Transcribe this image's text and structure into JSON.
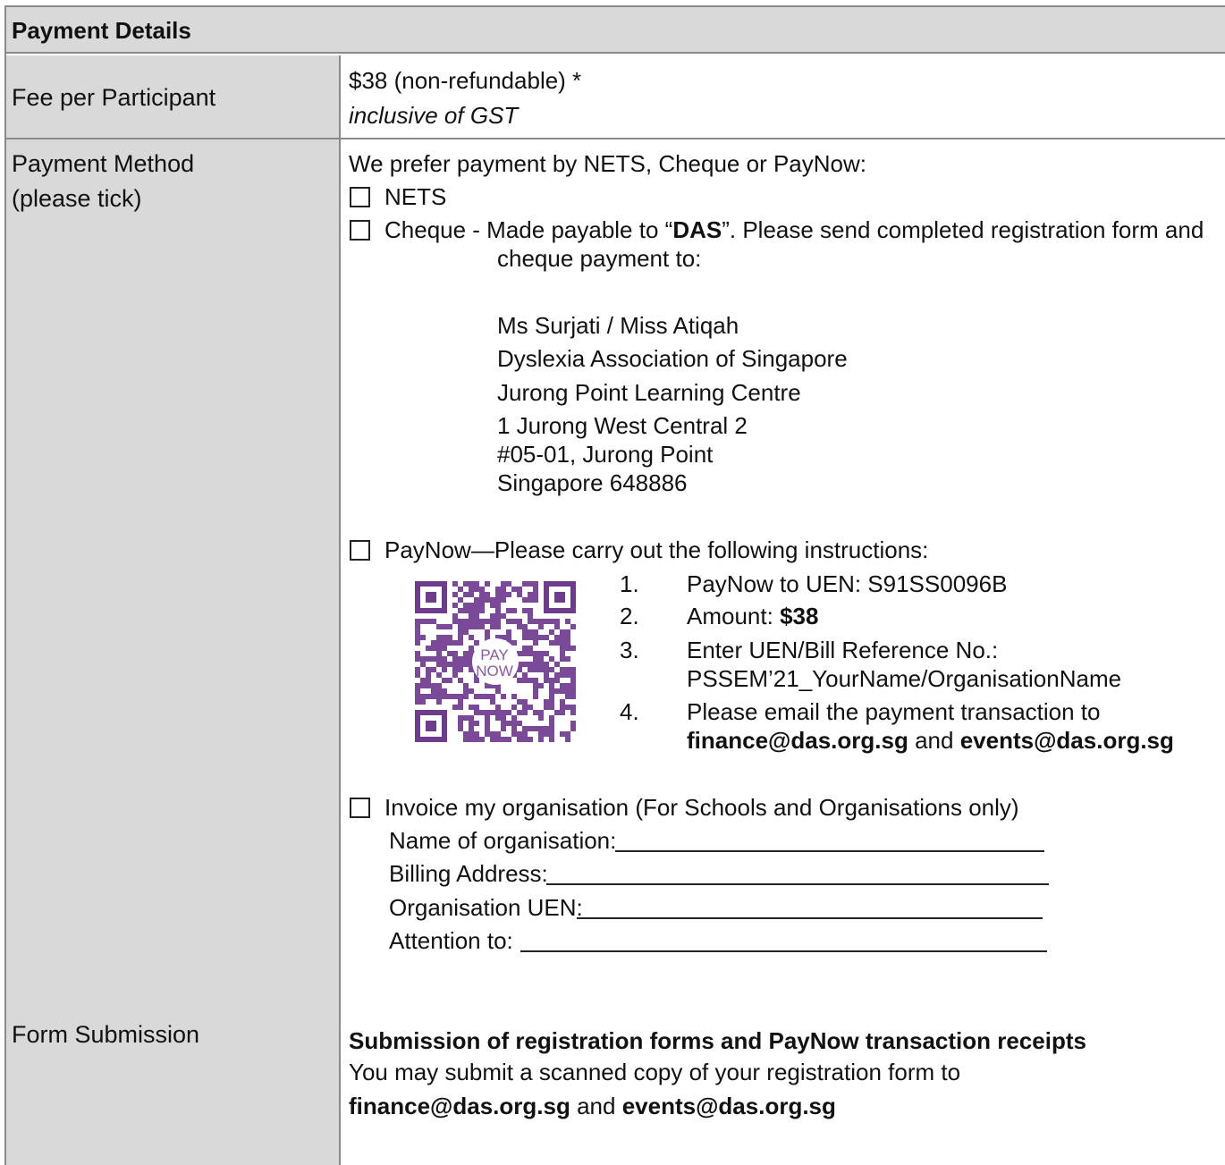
{
  "header": {
    "title": "Payment Details"
  },
  "fee": {
    "label": "Fee per Participant",
    "amount": "$38 (non-refundable) *",
    "note": "inclusive of GST"
  },
  "method": {
    "label_line1": "Payment Method",
    "label_line2": "(please tick)",
    "intro": "We prefer payment by NETS, Cheque or PayNow:",
    "nets_label": "NETS",
    "cheque": {
      "prefix": "Cheque - Made payable to  “",
      "payee": "DAS",
      "suffix": "”. Please send completed registration form and",
      "line2": "cheque payment to:",
      "address": [
        "Ms Surjati / Miss Atiqah",
        "Dyslexia Association of Singapore",
        "Jurong Point Learning Centre",
        "1 Jurong West Central 2",
        "#05-01, Jurong Point",
        "Singapore 648886"
      ]
    },
    "paynow": {
      "label": "PayNow—Please carry out the following instructions:",
      "qr_logo_top": "PAY",
      "qr_logo_bottom": "NOW",
      "steps": {
        "n1": "1.",
        "s1": "PayNow to UEN: S91SS0096B",
        "n2": "2.",
        "s2_prefix": "Amount: ",
        "s2_amount": "$38",
        "n3": "3.",
        "s3_line1": "Enter UEN/Bill Reference No.:",
        "s3_line2": "PSSEM’21_YourName/OrganisationName",
        "n4": "4.",
        "s4_line1": "Please email the payment transaction to",
        "s4_email1": "finance@das.org.sg",
        "s4_and": " and ",
        "s4_email2": "events@das.org.sg"
      }
    },
    "invoice": {
      "label": "Invoice my organisation (For Schools and Organisations only)",
      "fields": {
        "name": "Name of organisation:",
        "billing": "Billing Address:",
        "uen": "Organisation UEN:",
        "attention": "Attention to:"
      }
    }
  },
  "submission": {
    "label": "Form Submission",
    "heading": "Submission of registration forms and PayNow transaction receipts",
    "text": "You may submit a scanned copy of your registration form to",
    "email1": "finance@das.org.sg",
    "and": " and ",
    "email2": "events@das.org.sg"
  }
}
